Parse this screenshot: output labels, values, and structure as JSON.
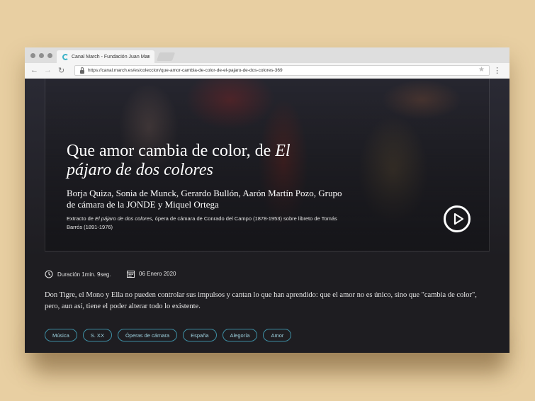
{
  "browser": {
    "tab_title": "Canal March - Fundación Juan Mar",
    "tab_close": "×",
    "url": "https://canal.march.es/es/coleccion/que-amor-cambia-de-color-de-el-pajaro-de-dos-colores-369",
    "back_icon": "arrow-left-icon",
    "forward_icon": "arrow-right-icon",
    "reload_icon": "reload-icon",
    "back_glyph": "←",
    "forward_glyph": "→",
    "reload_glyph": "↻",
    "star_glyph": "★",
    "menu_glyph": "⋮"
  },
  "hero": {
    "title_plain": "Que amor cambia de color, de ",
    "title_italic": "El pájaro de dos colores",
    "authors": "Borja Quiza, Sonia de Munck, Gerardo Bullón, Aarón Martín Pozo, Grupo de cámara de la JONDE y Miquel Ortega",
    "excerpt_prefix": "Extracto de ",
    "excerpt_italic": "El pájaro de dos colores",
    "excerpt_suffix": ", ópera de cámara de Conrado del Campo (1878-1953) sobre libreto de Tomás Barrós (1891-1976)"
  },
  "meta": {
    "duration": "Duración 1min. 9seg.",
    "date": "06 Enero 2020"
  },
  "description": "Don Tigre, el Mono y Ella no pueden controlar sus impulsos y cantan lo que han aprendido: que el amor no es único, sino que \"cambia de color\", pero, aun así, tiene el poder alterar todo lo existente.",
  "tags": [
    "Música",
    "S. XX",
    "Óperas de cámara",
    "España",
    "Alegoría",
    "Amor"
  ],
  "colors": {
    "background": "#e8cfa2",
    "page": "#1e1d21",
    "tag_border": "#3e8fa5",
    "brand": "#3bb3c7"
  }
}
